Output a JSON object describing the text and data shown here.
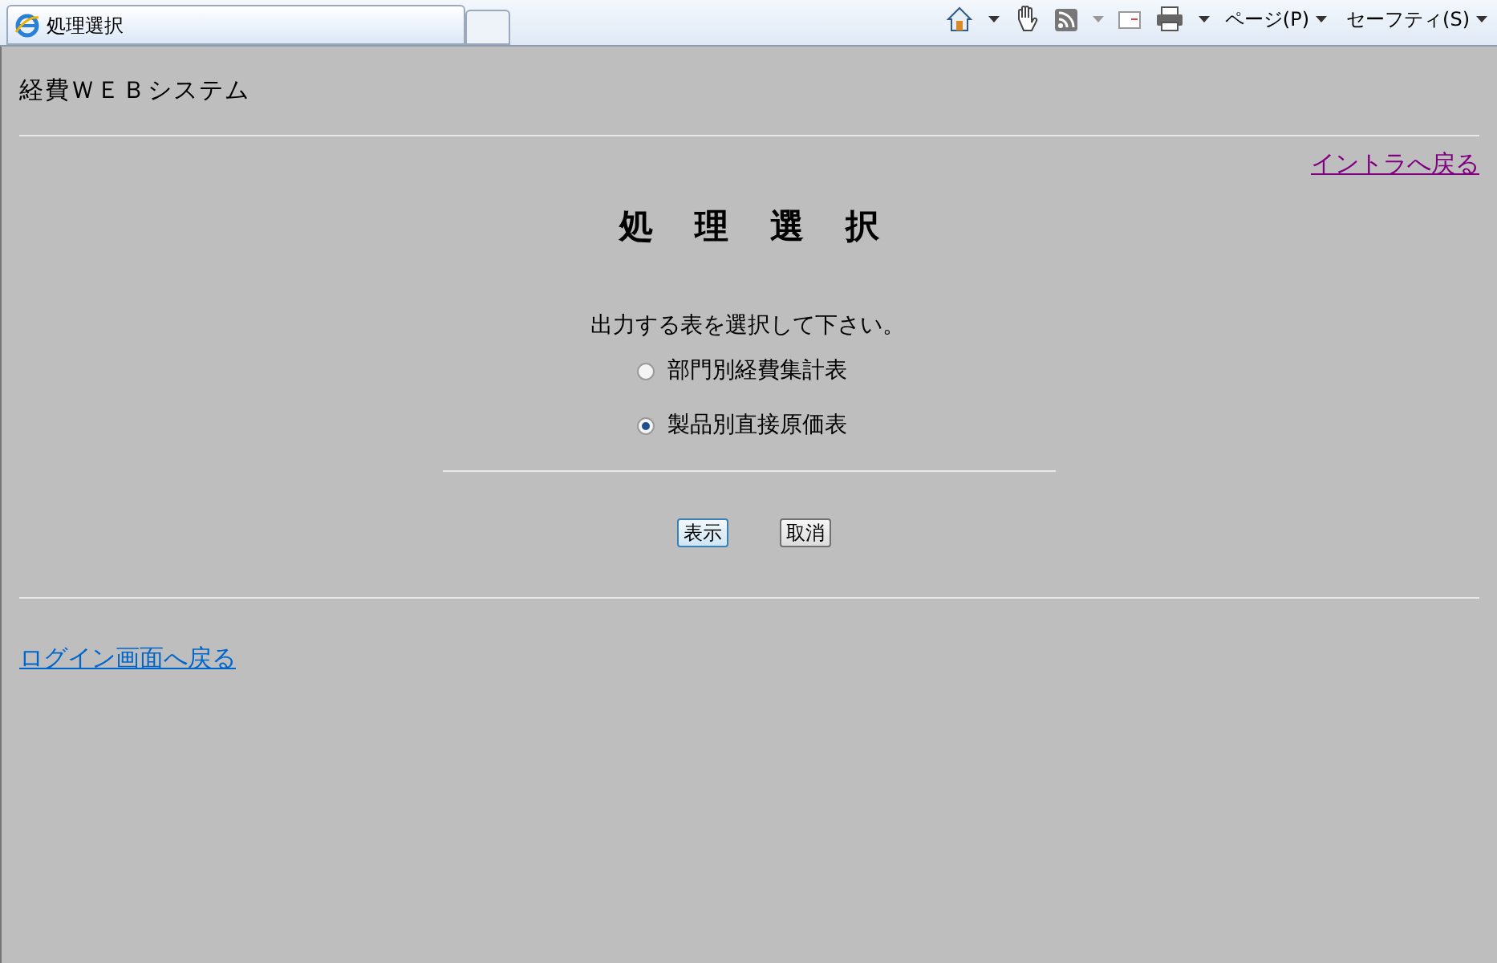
{
  "browser": {
    "tab_title": "処理選択",
    "menus": [
      {
        "label": "ページ(P)"
      },
      {
        "label": "セーフティ(S)"
      }
    ]
  },
  "page": {
    "system_title": "経費ＷＥＢシステム",
    "intranet_link": {
      "label": "イントラへ戻る",
      "visited": true
    },
    "heading": "処理選択",
    "prompt": "出力する表を選択して下さい。",
    "options": [
      {
        "label": "部門別経費集計表",
        "selected": false
      },
      {
        "label": "製品別直接原価表",
        "selected": true
      }
    ],
    "buttons": [
      {
        "label": "表示",
        "focused": true
      },
      {
        "label": "取消",
        "focused": false
      }
    ],
    "login_link": {
      "label": "ログイン画面へ戻る",
      "visited": false
    }
  }
}
